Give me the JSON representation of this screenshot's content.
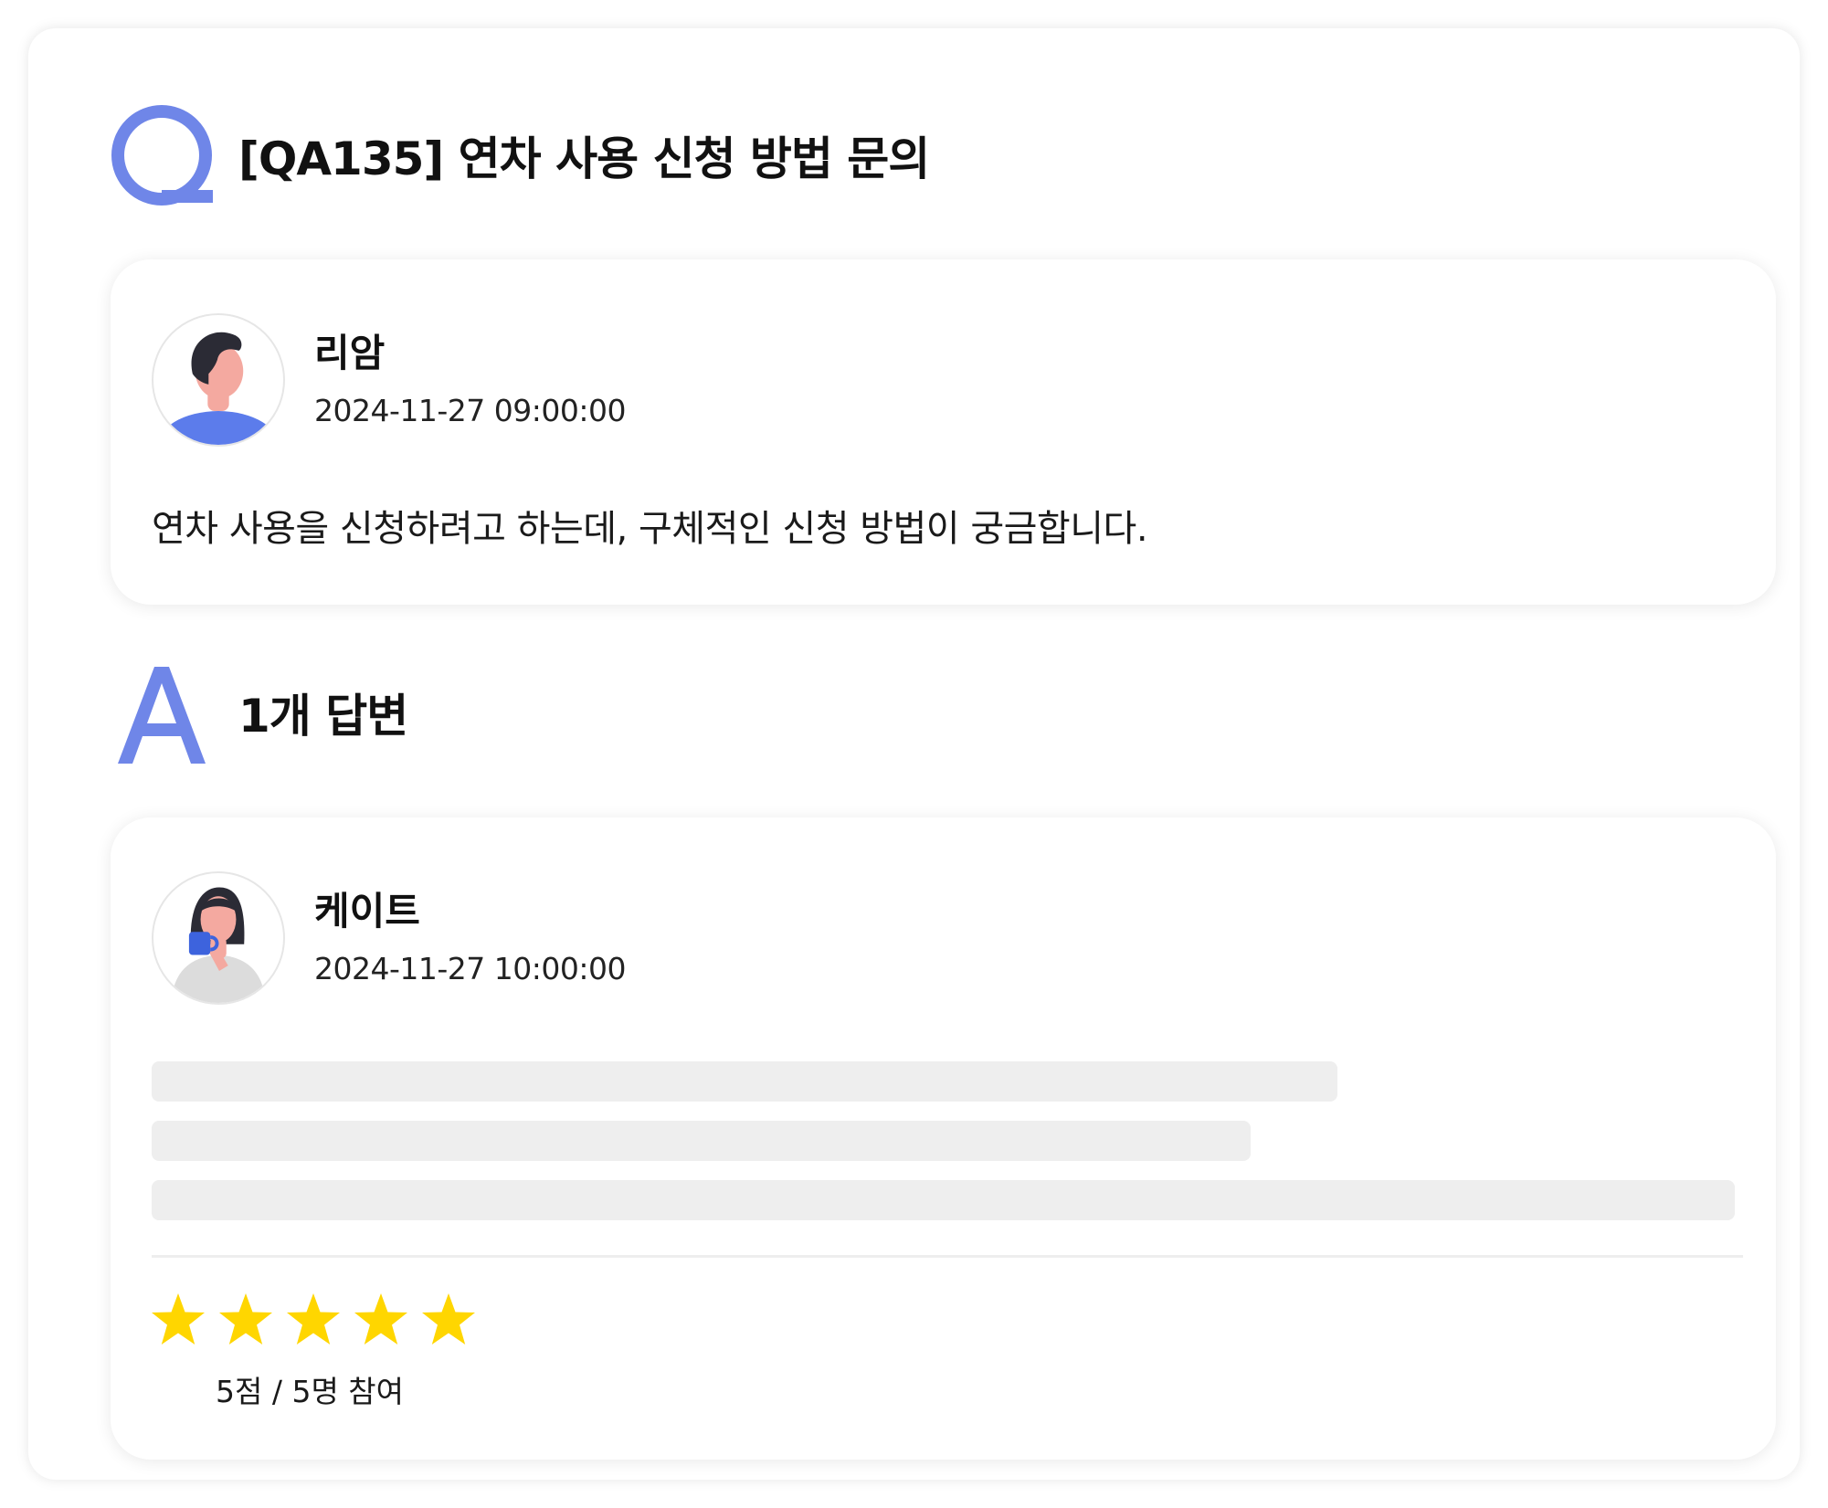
{
  "question": {
    "title": "[QA135] 연차 사용 신청 방법 문의",
    "author": "리암",
    "date": "2024-11-27 09:00:00",
    "body": "연차 사용을 신청하려고 하는데, 구체적인 신청 방법이 궁금합니다.",
    "avatar_icon": "male-user-avatar-icon",
    "mark_icon": "q-letter-icon"
  },
  "answers": {
    "title": "1개 답변",
    "mark_icon": "a-letter-icon",
    "items": [
      {
        "author": "케이트",
        "date": "2024-11-27 10:00:00",
        "avatar_icon": "female-user-avatar-icon",
        "body_state": "loading-skeleton",
        "rating": {
          "stars": 5,
          "max": 5,
          "text": "5점 / 5명 참여",
          "star_icon": "star-icon"
        }
      }
    ]
  },
  "colors": {
    "accent": "#6F86E8",
    "star": "#FFD600",
    "skeleton": "#EEEEEE",
    "skin": "#F4A9A0",
    "hair": "#2B2B35",
    "shirt_blue": "#5C7CEB"
  }
}
